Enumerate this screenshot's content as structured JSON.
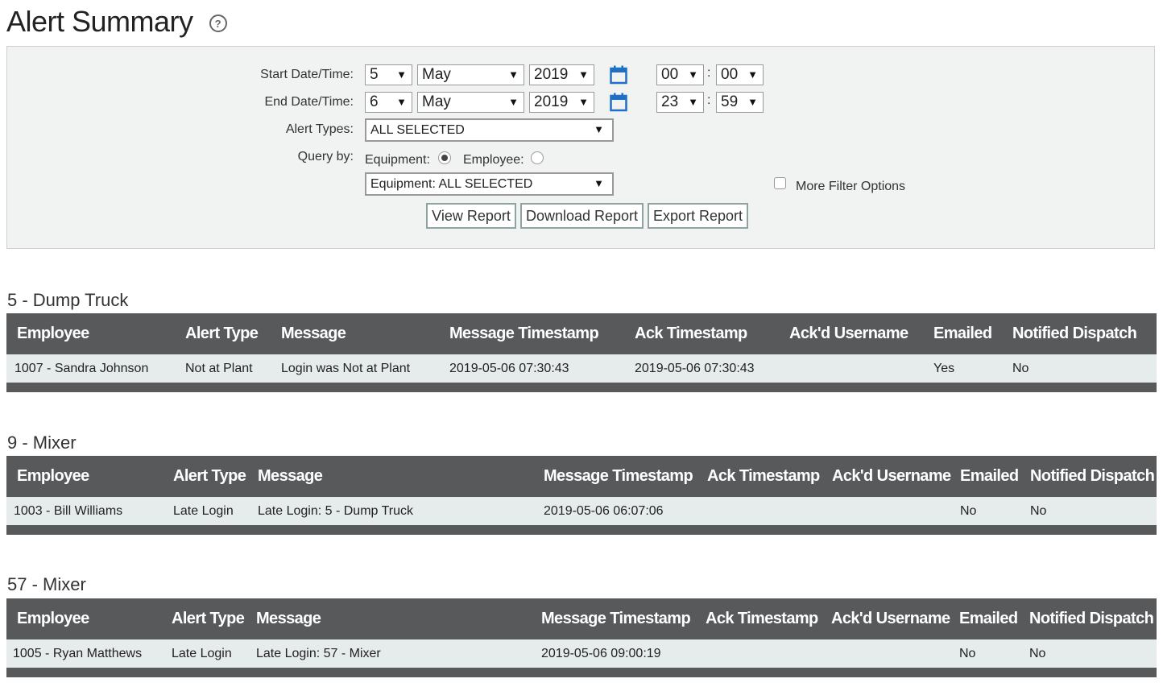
{
  "page": {
    "title": "Alert Summary"
  },
  "filters": {
    "start_label": "Start Date/Time:",
    "end_label": "End Date/Time:",
    "start": {
      "day": "5",
      "month": "May",
      "year": "2019",
      "hour": "00",
      "minute": "00"
    },
    "end": {
      "day": "6",
      "month": "May",
      "year": "2019",
      "hour": "23",
      "minute": "59"
    },
    "time_separator": ":",
    "alert_types_label": "Alert Types:",
    "alert_types_value": "ALL SELECTED",
    "query_by_label": "Query by:",
    "equipment_radio_label": "Equipment:",
    "employee_radio_label": "Employee:",
    "query_by_selected": "Equipment",
    "equipment_select_value": "Equipment: ALL SELECTED",
    "more_filter_label": "More Filter Options",
    "more_filter_checked": false,
    "view_report_label": "View Report",
    "download_report_label": "Download Report",
    "export_report_label": "Export Report"
  },
  "columns": [
    "Employee",
    "Alert Type",
    "Message",
    "Message Timestamp",
    "Ack Timestamp",
    "Ack'd Username",
    "Emailed",
    "Notified Dispatch"
  ],
  "groups": [
    {
      "title": "5 - Dump Truck",
      "rows": [
        {
          "employee": "1007 - Sandra Johnson",
          "alert_type": "Not at Plant",
          "message": "Login was Not at Plant",
          "message_timestamp": "2019-05-06 07:30:43",
          "ack_timestamp": "2019-05-06 07:30:43",
          "ackd_username": "",
          "emailed": "Yes",
          "notified_dispatch": "No"
        }
      ]
    },
    {
      "title": "9 - Mixer",
      "rows": [
        {
          "employee": "1003 - Bill Williams",
          "alert_type": "Late Login",
          "message": "Late Login:  5 - Dump Truck",
          "message_timestamp": "2019-05-06 06:07:06",
          "ack_timestamp": "",
          "ackd_username": "",
          "emailed": "No",
          "notified_dispatch": "No"
        }
      ]
    },
    {
      "title": "57 - Mixer",
      "rows": [
        {
          "employee": "1005 - Ryan Matthews",
          "alert_type": "Late Login",
          "message": "Late Login:  57 - Mixer",
          "message_timestamp": "2019-05-06 09:00:19",
          "ack_timestamp": "",
          "ackd_username": "",
          "emailed": "No",
          "notified_dispatch": "No"
        }
      ]
    }
  ],
  "colors": {
    "header_bg": "#58595b",
    "row_bg": "#e6ebeb",
    "panel_bg": "#f1f2f2",
    "calendar_blue": "#1f6fc5"
  }
}
